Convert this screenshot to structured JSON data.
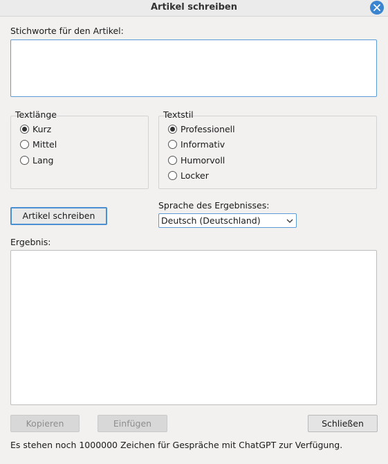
{
  "window": {
    "title": "Artikel schreiben"
  },
  "keywords": {
    "label": "Stichworte für den Artikel:",
    "value": ""
  },
  "text_length": {
    "legend": "Textlänge",
    "options": [
      {
        "label": "Kurz",
        "checked": true
      },
      {
        "label": "Mittel",
        "checked": false
      },
      {
        "label": "Lang",
        "checked": false
      }
    ]
  },
  "text_style": {
    "legend": "Textstil",
    "options": [
      {
        "label": "Professionell",
        "checked": true
      },
      {
        "label": "Informativ",
        "checked": false
      },
      {
        "label": "Humorvoll",
        "checked": false
      },
      {
        "label": "Locker",
        "checked": false
      }
    ]
  },
  "actions": {
    "write_label": "Artikel schreiben",
    "copy_label": "Kopieren",
    "insert_label": "Einfügen",
    "close_label": "Schließen"
  },
  "language": {
    "label": "Sprache des Ergebnisses:",
    "selected": "Deutsch (Deutschland)"
  },
  "result": {
    "label": "Ergebnis:",
    "value": ""
  },
  "status": {
    "text": "Es stehen noch 1000000 Zeichen für Gespräche mit ChatGPT zur Verfügung."
  }
}
